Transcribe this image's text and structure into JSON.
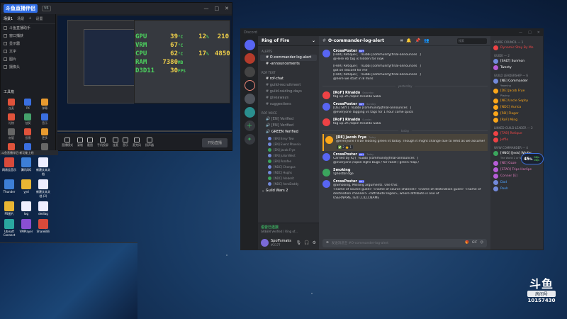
{
  "stream_app": {
    "title": "斗鱼直播伴侣",
    "version_badge": "V6",
    "window_buttons": [
      "—",
      "□",
      "✕"
    ],
    "source_tabs": [
      "场景1",
      "场景",
      "+",
      "设置"
    ],
    "sources": [
      "斗鱼直播助手",
      "窗口捕获",
      "显示器",
      "文字",
      "图片",
      "摄像头"
    ],
    "tools_title": "工具箱",
    "tools": [
      "连麦",
      "PK",
      "弹幕",
      "礼物",
      "抽奖",
      "音乐",
      "房管",
      "投票",
      "更多",
      "美颜",
      "特效",
      "设置"
    ],
    "hw_monitor": [
      {
        "k": "GPU",
        "v1": "39",
        "u": "°C",
        "v2": "12",
        "u2": "%",
        "v3": "210",
        "u3": "MHz"
      },
      {
        "k": "VRM",
        "v1": "67",
        "u": "°C",
        "v2": "",
        "u2": "",
        "v3": "",
        "u3": ""
      },
      {
        "k": "CPU",
        "v1": "62",
        "u": "°C",
        "v2": "17",
        "u2": "%",
        "v3": "4850",
        "u3": "MHz"
      },
      {
        "k": "RAM",
        "v1": "7380",
        "u": "MB",
        "v2": "",
        "u2": "",
        "v3": "",
        "u3": ""
      },
      {
        "k": "D3D11",
        "v1": "30",
        "u": "FPS",
        "v2": "",
        "u2": "",
        "v3": "",
        "u3": ""
      }
    ],
    "toolbar": [
      "直播模式",
      "录制",
      "截图",
      "手机投屏",
      "连麦",
      "音乐",
      "麦克风",
      "扬声器"
    ],
    "go_live_label": "开始直播",
    "notice": "斗鱼直播伴侣-新功能上线"
  },
  "desktop_icons": [
    "网易云音乐",
    "腾讯QQ",
    "新建文本文档",
    "Thunder",
    "yyd",
    "新建文本文档 (2)",
    "PS图片",
    "log",
    "dediag",
    "Ubisoft Connect",
    "VMPlayer",
    "ShareBilli"
  ],
  "discord": {
    "title": "Discord",
    "server_name": "Ring of Fire",
    "server_chevron": "⌄",
    "categories": {
      "alerts": "ALERTS",
      "text": "RoF TEXT",
      "voice": "RoF VOICE"
    },
    "alert_channels": [
      "O-commander-log-alert",
      "-announcements"
    ],
    "text_channels": [
      "rof-chat",
      "guild-recruitment",
      "guild-raiding-days",
      "giveaways",
      "suggestions"
    ],
    "voice_channels": [
      "[EN] Verified",
      "[EN] Verified",
      "GREEN Verified"
    ],
    "voice_users": [
      "[EN] Envy Tow",
      "[EN] Event Phoenix",
      "[EN] Jacob Frye",
      "[EN] JulianWest",
      "[EN] Porofee",
      "[NDC] Chongus",
      "[NDC] Hughs",
      "[NDC] Aleberit",
      "[NDC] AeroDaddy"
    ],
    "other_server": "Guild Wars 2",
    "voice_status": "语音已连接",
    "voice_sub": "GREEN Verified / Ring of...",
    "user_name": "Spoffsmaks",
    "user_tag": "#2177",
    "channel_title": "O-commander-log-alert",
    "search_placeholder": "搜索",
    "messages": [
      {
        "author": "CrossPoster",
        "bot": "BOT",
        "time": "",
        "lines": [
          "[FAIR] Retique [ `!subbi |community|final-announces` ]",
          "@Here eb tag is hidden for now"
        ],
        "av": "b"
      },
      {
        "author": "",
        "bot": "",
        "time": "",
        "lines": [
          "[FAIR] Retique [ `!subbi |community|final-announces` ]",
          "got on discord for me",
          "[FAIR] Retique [ `!subbi |community|final-announces` ]",
          "@here we start in 8 mins"
        ],
        "av": "none"
      },
      {
        "author": "[RoF] Rinaldo",
        "bot": "",
        "time": "Saturday",
        "lines": [
          "tag up 2h /sqoin Rinaldo Saka"
        ],
        "av": "r"
      },
      {
        "author": "CrossPoster",
        "bot": "BOT",
        "time": "Sunday",
        "lines": [
          "[DE] SKY [`!subbi |community|final-announces` ]",
          "@everyone Tagging vs tags for 1 hour come quick"
        ],
        "av": "b"
      },
      {
        "author": "[RoF] Rinaldo",
        "bot": "",
        "time": "Sunday",
        "lines": [
          "tag up 2h /sqoin Rinaldo Saka"
        ],
        "av": "r"
      },
      {
        "author": "[DE] Jacob Frye",
        "bot": "",
        "time": "Today",
        "lines": [
          "@everyone I'll be leading green lit today. Though it might change due to rehit as we assume!"
        ],
        "av": "o",
        "highlight": true
      },
      {
        "author": "CrossPoster",
        "bot": "BOT",
        "time": "Today",
        "lines": [
          "Carried by IQ [`!subbi |community|final-announces` ]",
          "@everyone /sqoin Ughs Bugs / for roast / green map /"
        ],
        "av": "b"
      },
      {
        "author": "Smoking",
        "bot": "",
        "time": "",
        "lines": [
          "!ghostbridge"
        ],
        "av": "g"
      },
      {
        "author": "CrossPoster",
        "bot": "BOT",
        "time": "",
        "lines": [
          "@Smoking, Missing arguments. Use this:",
          "<name of source guild> <name of source channel> <name of destination guild> <name of",
          "destination channel> <attribute:regex>, where attribute is one of",
          "USERNAME,TEXT,CID,CNAME"
        ],
        "av": "b"
      }
    ],
    "date_dividers": [
      "yesterday",
      "today"
    ],
    "reaction": "✅ 2  👍 1",
    "composer_placeholder": "发送消息至 #O-commander-log-alert",
    "member_groups": [
      {
        "title": "GUIDE COUNCIL — 1",
        "members": [
          {
            "n": "Dynamic Stay By Me",
            "c": "red",
            "av": "r"
          }
        ]
      },
      {
        "title": "GUIDE — 2",
        "members": [
          {
            "n": "[SALT] Sunmon",
            "c": "",
            "av": ""
          },
          {
            "n": "Twenty",
            "c": "",
            "av": "p"
          }
        ]
      },
      {
        "title": "GUILD LEADERSHIP — 6",
        "members": [
          {
            "n": "[NE] Commander",
            "c": "",
            "av": ""
          },
          {
            "n": "[DE] Jacob Frye",
            "c": "orange",
            "av": "o"
          },
          {
            "n": "[NE] Uncle Sephy",
            "c": "orange",
            "av": "o"
          },
          {
            "n": "[NDC] Aurica",
            "c": "orange",
            "av": "o"
          },
          {
            "n": "[RD] Flagor",
            "c": "orange",
            "av": "o"
          },
          {
            "n": "[RoF] Ming",
            "c": "orange",
            "av": "o"
          }
        ]
      },
      {
        "title": "LINKED GUILD LEADER — 2",
        "members": [
          {
            "n": "[TAB] Retique",
            "c": "red",
            "av": "r"
          },
          {
            "n": "Jeffio",
            "c": "red",
            "av": "r"
          }
        ]
      },
      {
        "title": "WVW COMMANDER — 4",
        "members": [
          {
            "n": "[HNG] [Jeds] Wipfer",
            "c": "",
            "av": "g"
          },
          {
            "n": "[NE] Gaze",
            "c": "pink",
            "av": "p"
          },
          {
            "n": "[STAR] Trips Harlips",
            "c": "pink",
            "av": "p"
          },
          {
            "n": "Conner [E]",
            "c": "pink",
            "av": "p"
          }
        ]
      },
      {
        "title": "",
        "members": [
          {
            "n": "Dad",
            "c": "blue",
            "av": ""
          },
          {
            "n": "Pooh",
            "c": "blue",
            "av": ""
          }
        ]
      }
    ],
    "member_subs": {
      "[NE] Commander": "Yeaming",
      "[DE] Jacob Frye": "Playing",
      "[HNG] [Jeds] Wipfer": "The World 2 or Nice"
    }
  },
  "float_widget": {
    "pct": "45",
    "unit": "%",
    "up": "0K/s",
    "down": "0K/s"
  },
  "douyu": {
    "logo": "斗鱼",
    "room_label": "房间号",
    "room_number": "10157430"
  },
  "colors": {
    "discord_bg": "#36393f",
    "discord_sidebar": "#2f3136",
    "blurple": "#5865f2",
    "hw_label": "#4cd35e",
    "hw_value": "#f0d04a"
  }
}
